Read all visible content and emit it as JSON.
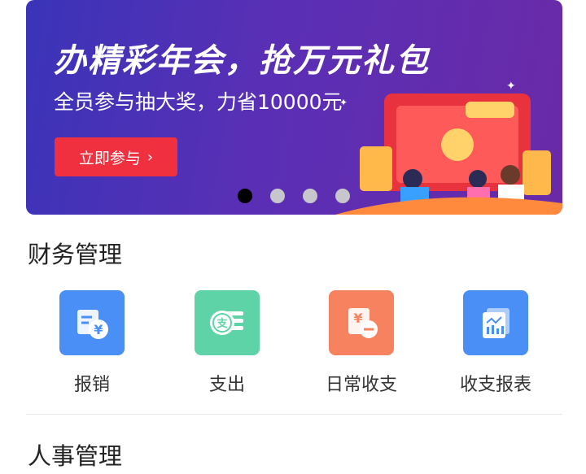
{
  "banner": {
    "title": "办精彩年会，抢万元礼包",
    "subtitle": "全员参与抽大奖，力省10000元",
    "cta_label": "立即参与",
    "cta_chevron": "›",
    "page_count": 4,
    "active_page": 1
  },
  "sections": {
    "finance": {
      "title": "财务管理",
      "items": [
        {
          "label": "报销",
          "icon": "reimbursement-icon",
          "color": "#4a8ff5"
        },
        {
          "label": "支出",
          "icon": "expense-icon",
          "color": "#5fd3a8"
        },
        {
          "label": "日常收支",
          "icon": "daily-income-expense-icon",
          "color": "#f6825f"
        },
        {
          "label": "收支报表",
          "icon": "report-icon",
          "color": "#4a8ff5"
        }
      ]
    },
    "hr": {
      "title": "人事管理"
    }
  }
}
